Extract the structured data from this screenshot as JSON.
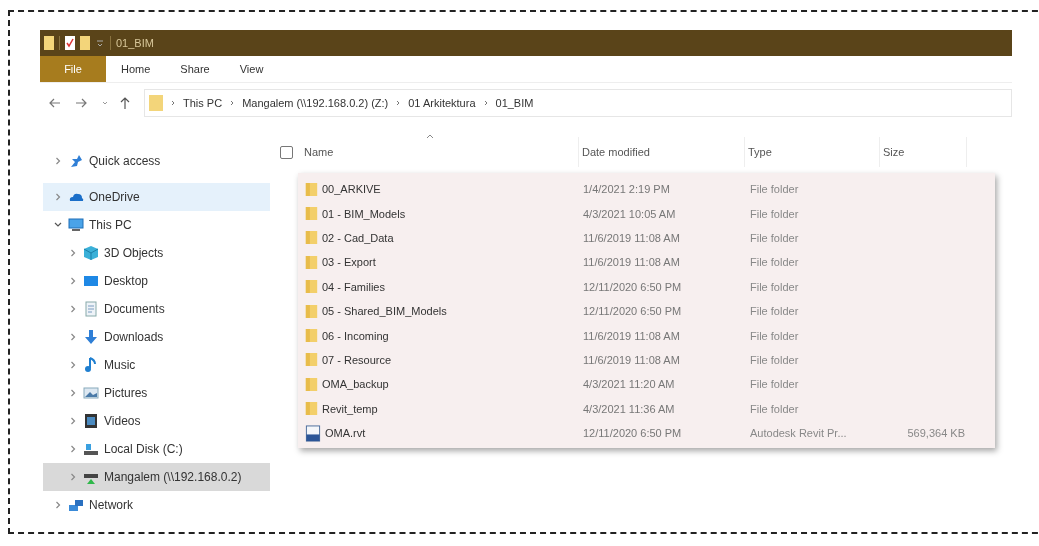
{
  "window": {
    "title": "01_BIM"
  },
  "ribbon_tabs": [
    {
      "label": "File",
      "selected": true
    },
    {
      "label": "Home",
      "selected": false
    },
    {
      "label": "Share",
      "selected": false
    },
    {
      "label": "View",
      "selected": false
    }
  ],
  "breadcrumb": [
    "This PC",
    "Mangalem (\\\\192.168.0.2) (Z:)",
    "01 Arkitektura",
    "01_BIM"
  ],
  "sidebar": {
    "items": [
      {
        "label": "Quick access",
        "kind": "star",
        "expanded": false,
        "selected": false,
        "hovered": false
      },
      {
        "label": "OneDrive",
        "kind": "cloud",
        "expanded": false,
        "selected": false,
        "hovered": true
      },
      {
        "label": "This PC",
        "kind": "pc",
        "expanded": true,
        "selected": false,
        "hovered": false,
        "children": [
          {
            "label": "3D Objects",
            "kind": "cube",
            "expanded": false,
            "selected": false,
            "hovered": false
          },
          {
            "label": "Desktop",
            "kind": "desktop",
            "expanded": false,
            "selected": false,
            "hovered": false
          },
          {
            "label": "Documents",
            "kind": "document",
            "expanded": false,
            "selected": false,
            "hovered": false
          },
          {
            "label": "Downloads",
            "kind": "download",
            "expanded": false,
            "selected": false,
            "hovered": false
          },
          {
            "label": "Music",
            "kind": "music",
            "expanded": false,
            "selected": false,
            "hovered": false
          },
          {
            "label": "Pictures",
            "kind": "picture",
            "expanded": false,
            "selected": false,
            "hovered": false
          },
          {
            "label": "Videos",
            "kind": "video",
            "expanded": false,
            "selected": false,
            "hovered": false
          },
          {
            "label": "Local Disk (C:)",
            "kind": "disk",
            "expanded": false,
            "selected": false,
            "hovered": false
          },
          {
            "label": "Mangalem (\\\\192.168.0.2)",
            "kind": "network-drive",
            "expanded": false,
            "selected": true,
            "hovered": false
          }
        ]
      },
      {
        "label": "Network",
        "kind": "network",
        "expanded": false,
        "selected": false,
        "hovered": false
      }
    ]
  },
  "table": {
    "select_all": {
      "checked": false
    },
    "columns": [
      "Name",
      "Date modified",
      "Type",
      "Size"
    ],
    "rows": [
      {
        "kind": "folder",
        "name": "00_ARKIVE",
        "date": "1/4/2021 2:19 PM",
        "type": "File folder"
      },
      {
        "kind": "folder",
        "name": "01 - BIM_Models",
        "date": "4/3/2021 10:05 AM",
        "type": "File folder"
      },
      {
        "kind": "folder",
        "name": "02 - Cad_Data",
        "date": "11/6/2019 11:08 AM",
        "type": "File folder"
      },
      {
        "kind": "folder",
        "name": "03 - Export",
        "date": "11/6/2019 11:08 AM",
        "type": "File folder"
      },
      {
        "kind": "folder",
        "name": "04 - Families",
        "date": "12/11/2020 6:50 PM",
        "type": "File folder"
      },
      {
        "kind": "folder",
        "name": "05 - Shared_BIM_Models",
        "date": "12/11/2020 6:50 PM",
        "type": "File folder"
      },
      {
        "kind": "folder",
        "name": "06 - Incoming",
        "date": "11/6/2019 11:08 AM",
        "type": "File folder"
      },
      {
        "kind": "folder",
        "name": "07 - Resource",
        "date": "11/6/2019 11:08 AM",
        "type": "File folder"
      },
      {
        "kind": "folder",
        "name": "OMA_backup",
        "date": "4/3/2021 11:20 AM",
        "type": "File folder"
      },
      {
        "kind": "folder",
        "name": "Revit_temp",
        "date": "4/3/2021 11:36 AM",
        "type": "File folder"
      },
      {
        "kind": "file",
        "name": "OMA.rvt",
        "date": "12/11/2020 6:50 PM",
        "type": "Autodesk Revit Pr...",
        "size": "569,364 KB"
      }
    ]
  }
}
